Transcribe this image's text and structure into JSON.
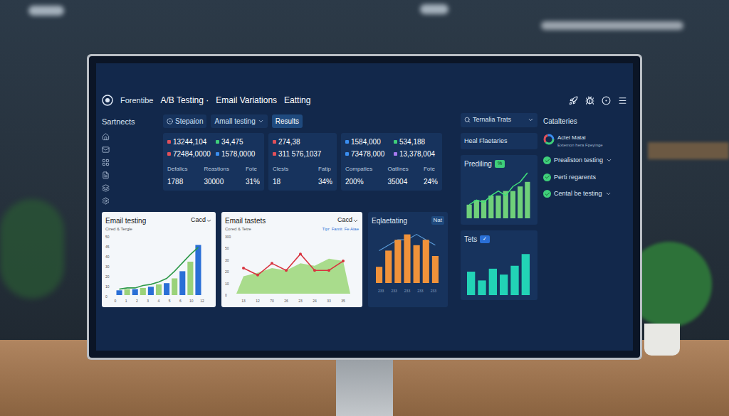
{
  "header": {
    "brand": "Forentibe",
    "crumbs": [
      "A/B Testing ·",
      "Email Variations",
      "Eatting"
    ]
  },
  "sidebar": {
    "title": "Sartnects"
  },
  "tabs": [
    {
      "label": "Stepaion",
      "selected": false,
      "dropdown": false
    },
    {
      "label": "Amall testing",
      "selected": false,
      "dropdown": true
    },
    {
      "label": "Results",
      "selected": true,
      "dropdown": false
    }
  ],
  "search": {
    "value": "Ternalia Trats"
  },
  "stat_cards": [
    {
      "values": [
        {
          "text": "13244,104",
          "color": "#e0505a"
        },
        {
          "text": "34,475",
          "color": "#3fcf7a"
        },
        {
          "text": "72484,0000",
          "color": "#e0505a"
        },
        {
          "text": "1578,0000",
          "color": "#3a8ef0"
        }
      ],
      "metrics": [
        {
          "label": "Defalics",
          "value": "1788"
        },
        {
          "label": "Reastions",
          "value": "30000"
        },
        {
          "label": "Fote",
          "value": "31%"
        }
      ]
    },
    {
      "values": [
        {
          "text": "274,38",
          "color": "#e0505a"
        },
        {
          "text": "311 576,1037",
          "color": "#e0505a"
        }
      ],
      "metrics": [
        {
          "label": "Clests",
          "value": "18"
        },
        {
          "label": "Fatip",
          "value": "34%"
        }
      ]
    },
    {
      "values": [
        {
          "text": "1584,000",
          "color": "#3a8ef0"
        },
        {
          "text": "534,188",
          "color": "#3fcf7a"
        },
        {
          "text": "73478,000",
          "color": "#3a8ef0"
        },
        {
          "text": "13,378,004",
          "color": "#a77af0"
        }
      ],
      "metrics": [
        {
          "label": "Compaties",
          "value": "200%"
        },
        {
          "label": "Oatlines",
          "value": "35004"
        },
        {
          "label": "Fote",
          "value": "24%"
        }
      ]
    }
  ],
  "feature_button": "Heal Flaetaries",
  "prediling": {
    "title": "Prediling",
    "badge": "%",
    "bars": [
      3,
      4,
      4,
      5,
      5,
      6,
      6,
      7,
      8
    ],
    "line": [
      3,
      4,
      3.5,
      5,
      6,
      5,
      7,
      8,
      10
    ]
  },
  "tets": {
    "title": "Tets",
    "badge": "✓",
    "bars": [
      4,
      2.5,
      4.5,
      3.5,
      5,
      7
    ]
  },
  "categories": {
    "title": "Catalteries",
    "featured": {
      "title": "Actel Matal",
      "subtitle": "Extemon hera Fpeyinge"
    },
    "items": [
      {
        "label": "Prealiston testing",
        "checked": true,
        "dropdown": true
      },
      {
        "label": "Perti regarents",
        "checked": true,
        "dropdown": false
      },
      {
        "label": "Cental be testing",
        "checked": true,
        "dropdown": true
      }
    ]
  },
  "charts": [
    {
      "title": "Email testing",
      "select": "Cacd",
      "subtitle": "Cired & Tergle",
      "y_ticks": [
        "50",
        "45",
        "40",
        "30",
        "20",
        "10",
        "0"
      ],
      "x_ticks": [
        "0",
        "1",
        "2",
        "3",
        "4",
        "5",
        "6",
        "10",
        "12"
      ],
      "max": 50,
      "bars": [
        4,
        5,
        5,
        6,
        7,
        9,
        10,
        14,
        20,
        28,
        42
      ],
      "line": [
        5,
        6,
        6,
        8,
        9,
        11,
        14,
        20,
        27,
        34,
        40
      ]
    },
    {
      "title": "Email tastets",
      "select": "Cacd",
      "subtitle": "Cored & Tetre",
      "legend": [
        "Tipr",
        "Famit",
        "Fe Aiae"
      ],
      "y_ticks": [
        "300",
        "50",
        "30",
        "20",
        "10",
        "0"
      ],
      "x_ticks": [
        "13",
        "12",
        "70",
        "26",
        "23",
        "24",
        "33",
        "35"
      ],
      "max": 50,
      "area": [
        15,
        18,
        22,
        20,
        26,
        24,
        30,
        28
      ],
      "line": [
        22,
        16,
        26,
        20,
        34,
        20,
        20,
        28
      ]
    },
    {
      "title": "Eqlaetating",
      "select": "Nat",
      "x_ticks": [
        "233",
        "233",
        "233",
        "233",
        "233"
      ],
      "max": 10,
      "bars": [
        3,
        6,
        8,
        9,
        7,
        8,
        5
      ],
      "line": [
        6,
        7,
        8,
        8,
        9,
        8,
        7
      ]
    }
  ]
}
